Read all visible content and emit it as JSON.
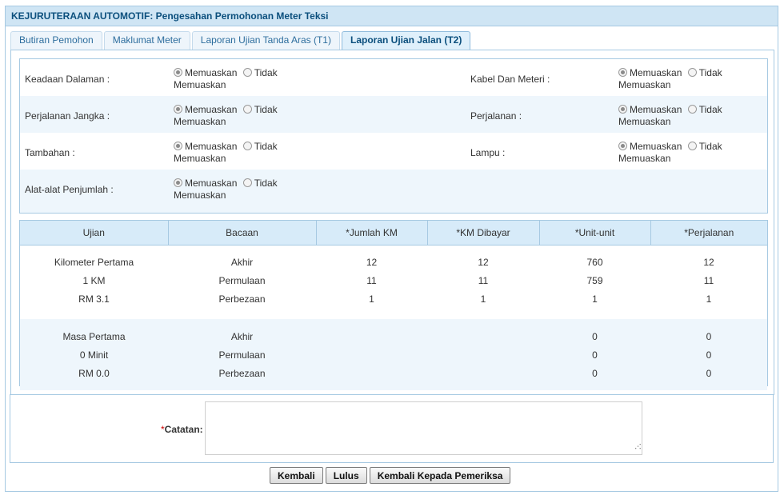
{
  "header": {
    "title": "KEJURUTERAAN AUTOMOTIF: Pengesahan Permohonan Meter Teksi"
  },
  "tabs": [
    {
      "label": "Butiran Pemohon",
      "active": false
    },
    {
      "label": "Maklumat Meter",
      "active": false
    },
    {
      "label": "Laporan Ujian Tanda Aras (T1)",
      "active": false
    },
    {
      "label": "Laporan Ujian Jalan (T2)",
      "active": true
    }
  ],
  "inspection": {
    "option_yes": "Memuaskan",
    "option_no_line1": "Tidak",
    "option_no_line2": "Memuaskan",
    "items": [
      {
        "label": "Keadaan Dalaman :",
        "selected": "Memuaskan"
      },
      {
        "label": "Kabel Dan Meteri :",
        "selected": "Memuaskan"
      },
      {
        "label": "Perjalanan Jangka :",
        "selected": "Memuaskan"
      },
      {
        "label": "Perjalanan :",
        "selected": "Memuaskan"
      },
      {
        "label": "Tambahan :",
        "selected": "Memuaskan"
      },
      {
        "label": "Lampu :",
        "selected": "Memuaskan"
      },
      {
        "label": "Alat-alat Penjumlah :",
        "selected": "Memuaskan"
      }
    ]
  },
  "table": {
    "headers": [
      "Ujian",
      "Bacaan",
      "*Jumlah KM",
      "*KM Dibayar",
      "*Unit-unit",
      "*Perjalanan"
    ],
    "group1": [
      [
        "Kilometer Pertama",
        "Akhir",
        "12",
        "12",
        "760",
        "12"
      ],
      [
        "1 KM",
        "Permulaan",
        "11",
        "11",
        "759",
        "11"
      ],
      [
        "RM 3.1",
        "Perbezaan",
        "1",
        "1",
        "1",
        "1"
      ]
    ],
    "group2": [
      [
        "Masa Pertama",
        "Akhir",
        "",
        "",
        "0",
        "0"
      ],
      [
        "0 Minit",
        "Permulaan",
        "",
        "",
        "0",
        "0"
      ],
      [
        "RM 0.0",
        "Perbezaan",
        "",
        "",
        "0",
        "0"
      ]
    ]
  },
  "notes": {
    "required_mark": "*",
    "label": "Catatan:",
    "value": ""
  },
  "buttons": {
    "back": "Kembali",
    "pass": "Lulus",
    "return_to_inspector": "Kembali Kepada Pemeriksa"
  }
}
